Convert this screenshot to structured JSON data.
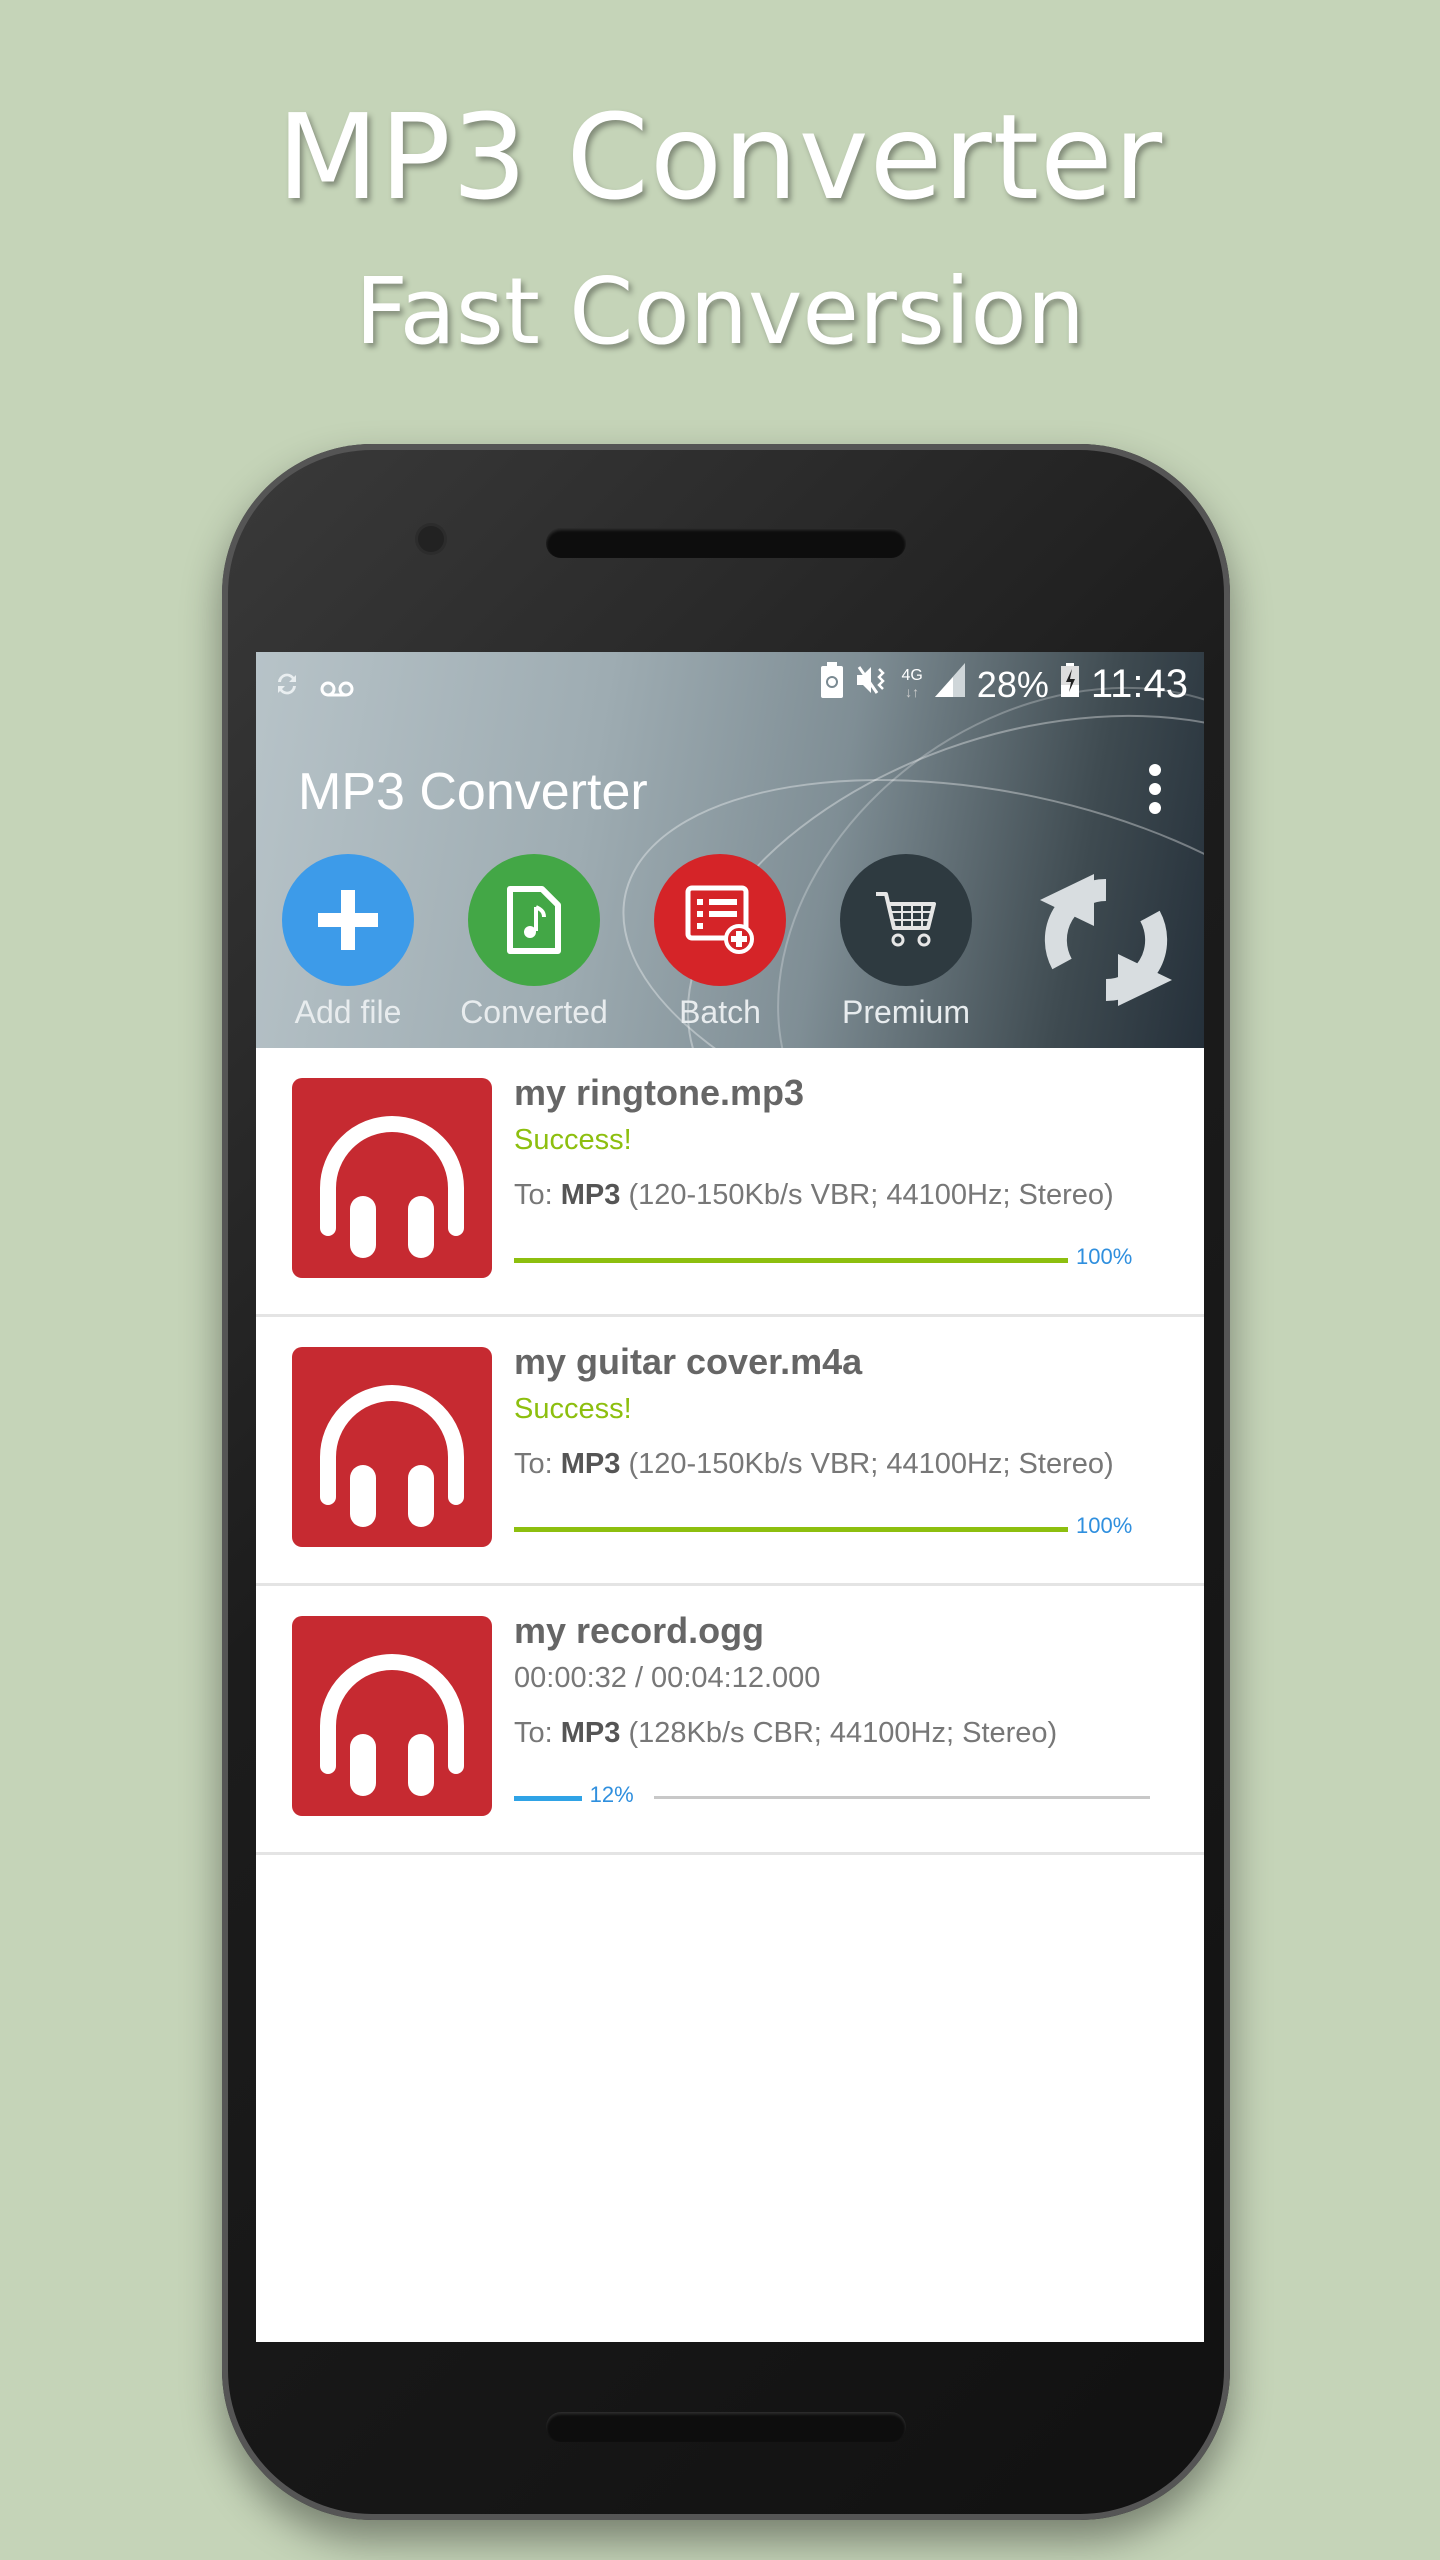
{
  "promo": {
    "title": "MP3 Converter",
    "subtitle": "Fast Conversion"
  },
  "statusbar": {
    "left_icons": [
      "sync-icon",
      "voicemail-icon"
    ],
    "right_icons": [
      "battery-saver-icon",
      "vibrate-mute-icon",
      "4g-icon",
      "signal-icon"
    ],
    "battery": "28%",
    "time": "11:43"
  },
  "appbar": {
    "title": "MP3 Converter",
    "menu_icon": "overflow-menu-icon"
  },
  "actions": [
    {
      "label": "Add file",
      "icon": "plus-icon",
      "color": "#3d9be9"
    },
    {
      "label": "Converted",
      "icon": "music-file-icon",
      "color": "#43a746"
    },
    {
      "label": "Batch",
      "icon": "batch-list-add-icon",
      "color": "#d52428"
    },
    {
      "label": "Premium",
      "icon": "cart-icon",
      "color": "#2e3a40"
    }
  ],
  "refresh_icon": "refresh-icon",
  "files": [
    {
      "name": "my ringtone.mp3",
      "status": "Success!",
      "to_prefix": "To: ",
      "format": "MP3",
      "settings": " (120-150Kb/s VBR; 44100Hz; Stereo)",
      "progress": 100,
      "progress_label": "100%",
      "progress_color": "#8dbf0f"
    },
    {
      "name": "my guitar cover.m4a",
      "status": "Success!",
      "to_prefix": "To: ",
      "format": "MP3",
      "settings": " (120-150Kb/s VBR; 44100Hz; Stereo)",
      "progress": 100,
      "progress_label": "100%",
      "progress_color": "#8dbf0f"
    },
    {
      "name": "my record.ogg",
      "status": "00:00:32 / 00:04:12.000",
      "to_prefix": "To: ",
      "format": "MP3",
      "settings": " (128Kb/s CBR; 44100Hz; Stereo)",
      "progress": 12,
      "progress_label": "12%",
      "progress_color": "#2fa3e6"
    }
  ]
}
